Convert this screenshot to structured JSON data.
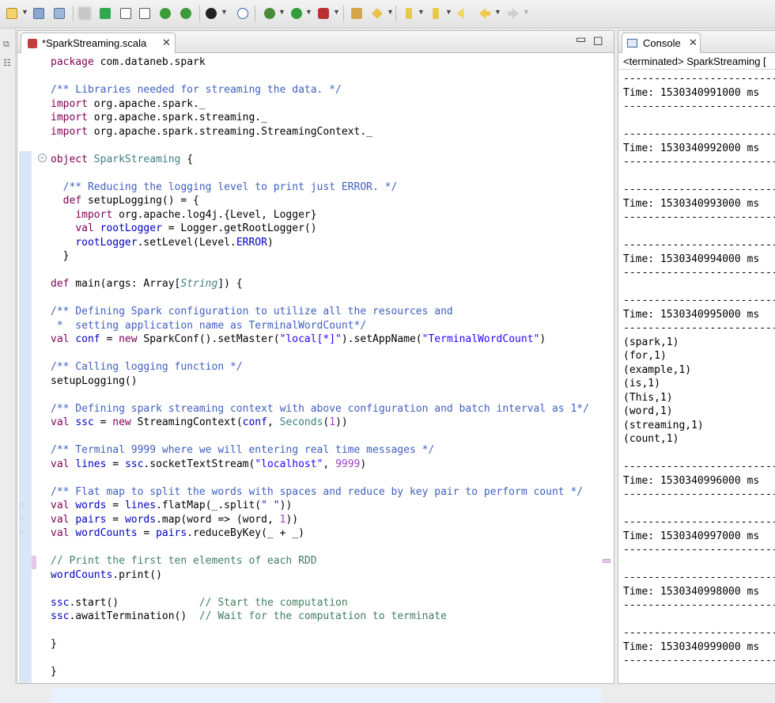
{
  "toolbar": {
    "icons": [
      "new-icon",
      "save-icon",
      "save-all-icon",
      "skip-icon",
      "outline-icon",
      "info-icon",
      "task-icon",
      "list-icon",
      "perspective-icon",
      "debug-step-icon",
      "bug-icon",
      "run-icon",
      "run-external-icon",
      "open-type-icon",
      "search-icon",
      "next-annotation-icon",
      "prev-edit-icon",
      "back-icon",
      "forward-icon"
    ]
  },
  "editor": {
    "tab_title": "*SparkStreaming.scala",
    "code_lines": [
      "package com.dataneb.spark",
      "",
      "/** Libraries needed for streaming the data. */",
      "import org.apache.spark._",
      "import org.apache.spark.streaming._",
      "import org.apache.spark.streaming.StreamingContext._",
      "",
      "object SparkStreaming {",
      "",
      "  /** Reducing the logging level to print just ERROR. */",
      "  def setupLogging() = {",
      "    import org.apache.log4j.{Level, Logger}",
      "    val rootLogger = Logger.getRootLogger()",
      "    rootLogger.setLevel(Level.ERROR)",
      "  }",
      "",
      "def main(args: Array[String]) {",
      "",
      "/** Defining Spark configuration to utilize all the resources and",
      " *  setting application name as TerminalWordCount*/",
      "val conf = new SparkConf().setMaster(\"local[*]\").setAppName(\"TerminalWordCount\")",
      "",
      "/** Calling logging function */",
      "setupLogging()",
      "",
      "/** Defining spark streaming context with above configuration and batch interval as 1*/",
      "val ssc = new StreamingContext(conf, Seconds(1))",
      "",
      "/** Terminal 9999 where we will entering real time messages */",
      "val lines = ssc.socketTextStream(\"localhost\", 9999)",
      "",
      "/** Flat map to split the words with spaces and reduce by key pair to perform count */",
      "val words = lines.flatMap(_.split(\" \"))",
      "val pairs = words.map(word => (word, 1))",
      "val wordCounts = pairs.reduceByKey(_ + _)",
      "",
      "// Print the first ten elements of each RDD",
      "wordCounts.print()",
      "",
      "ssc.start()             // Start the computation",
      "ssc.awaitTermination()  // Wait for the computation to terminate",
      "",
      "}",
      "",
      "}"
    ]
  },
  "console": {
    "tab_title": "Console",
    "header": "<terminated> SparkStreaming [",
    "lines": [
      "-----------------------------------",
      "Time: 1530340991000 ms",
      "-----------------------------------",
      "",
      "-----------------------------------",
      "Time: 1530340992000 ms",
      "-----------------------------------",
      "",
      "-----------------------------------",
      "Time: 1530340993000 ms",
      "-----------------------------------",
      "",
      "-----------------------------------",
      "Time: 1530340994000 ms",
      "-----------------------------------",
      "",
      "-----------------------------------",
      "Time: 1530340995000 ms",
      "-----------------------------------",
      "(spark,1)",
      "(for,1)",
      "(example,1)",
      "(is,1)",
      "(This,1)",
      "(word,1)",
      "(streaming,1)",
      "(count,1)",
      "",
      "-----------------------------------",
      "Time: 1530340996000 ms",
      "-----------------------------------",
      "",
      "-----------------------------------",
      "Time: 1530340997000 ms",
      "-----------------------------------",
      "",
      "-----------------------------------",
      "Time: 1530340998000 ms",
      "-----------------------------------",
      "",
      "-----------------------------------",
      "Time: 1530340999000 ms",
      "-----------------------------------"
    ]
  },
  "colors": {
    "keyword": "#7f0055",
    "javadoc": "#3f5fbf",
    "line_comment": "#3f7f5f",
    "string": "#2a00ff",
    "number": "#9a42c5",
    "type": "#3f7f7f",
    "field": "#0000c0"
  }
}
